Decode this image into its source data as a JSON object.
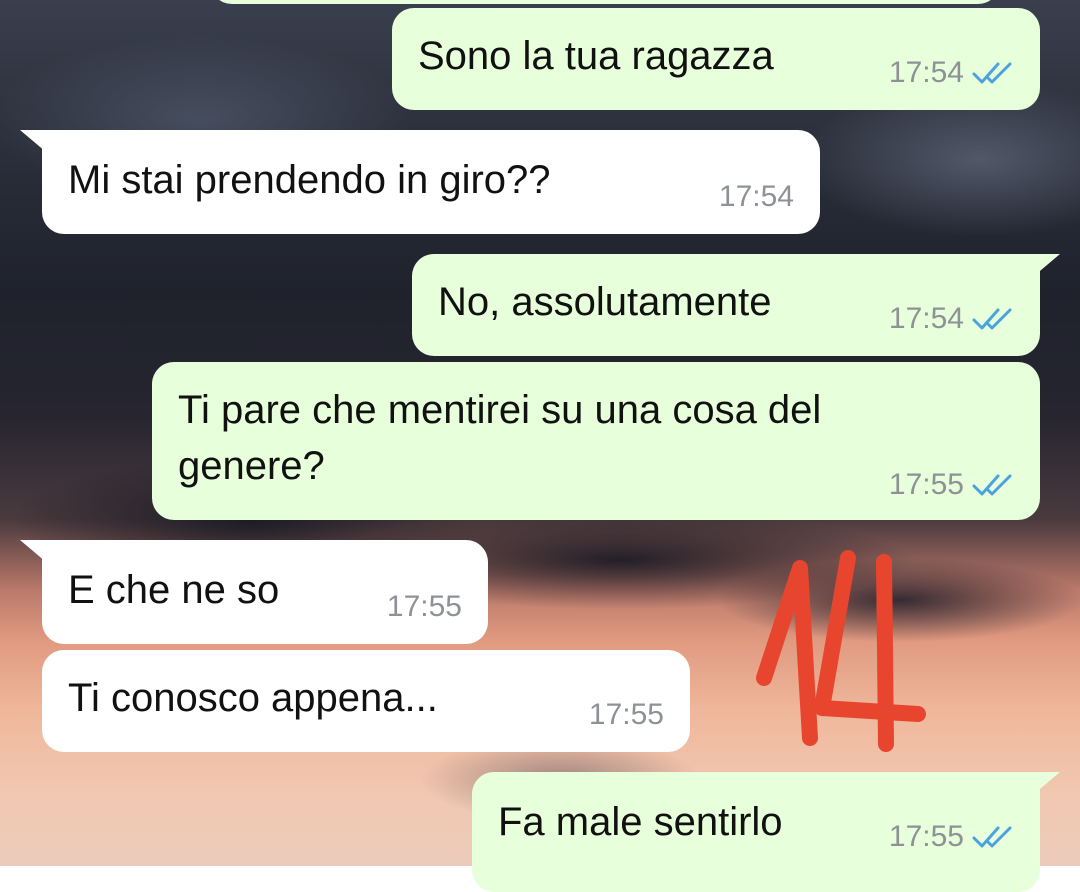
{
  "colors": {
    "outgoing_bubble": "#e7ffdb",
    "incoming_bubble": "#ffffff",
    "timestamp": "#8e9297",
    "read_ticks": "#4aa3df",
    "overlay_mark": "#e8452f"
  },
  "messages": [
    {
      "id": "m1",
      "direction": "out",
      "text": "Sono la tua ragazza",
      "time": "17:54",
      "status_icon": "double-check-read-icon"
    },
    {
      "id": "m2",
      "direction": "in",
      "text": "Mi stai prendendo in giro??",
      "time": "17:54"
    },
    {
      "id": "m3",
      "direction": "out",
      "text": "No, assolutamente",
      "time": "17:54",
      "status_icon": "double-check-read-icon"
    },
    {
      "id": "m4",
      "direction": "out",
      "text": "Ti pare che mentirei su una cosa del\ngenere?",
      "time": "17:55",
      "status_icon": "double-check-read-icon"
    },
    {
      "id": "m5",
      "direction": "in",
      "text": "E che ne so",
      "time": "17:55"
    },
    {
      "id": "m6",
      "direction": "in",
      "text": "Ti conosco appena...",
      "time": "17:55"
    },
    {
      "id": "m7",
      "direction": "out",
      "text": "Fa male sentirlo",
      "time": "17:55",
      "status_icon": "double-check-read-icon"
    }
  ],
  "overlay_number": "14"
}
